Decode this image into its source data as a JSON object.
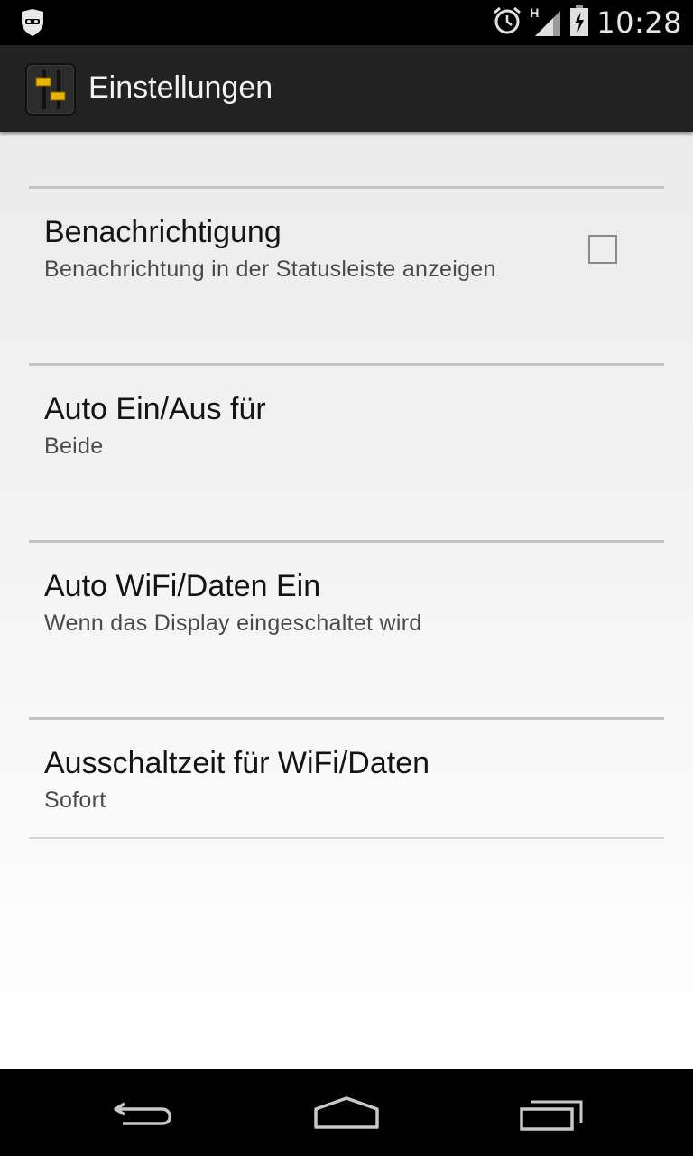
{
  "status_bar": {
    "time": "10:28",
    "network_label": "H",
    "icons": [
      "incognito-icon",
      "alarm-icon",
      "signal-icon",
      "battery-charging-icon"
    ]
  },
  "action_bar": {
    "title": "Einstellungen",
    "icon": "settings-sliders-icon"
  },
  "preferences": [
    {
      "title": "Benachrichtigung",
      "summary": "Benachrichtung in der Statusleiste anzeigen",
      "has_checkbox": true,
      "checked": false
    },
    {
      "title": "Auto Ein/Aus für",
      "summary": "Beide"
    },
    {
      "title": "Auto WiFi/Daten Ein",
      "summary": "Wenn das Display eingeschaltet wird"
    },
    {
      "title": "Ausschaltzeit für WiFi/Daten",
      "summary": "Sofort"
    }
  ],
  "nav_bar": {
    "buttons": [
      "back-icon",
      "home-icon",
      "recent-apps-icon"
    ]
  },
  "colors": {
    "status_bar": "#000000",
    "action_bar": "#222222",
    "divider": "#c4c4c4",
    "title_text": "#141414",
    "summary_text": "#4a4a4a"
  }
}
